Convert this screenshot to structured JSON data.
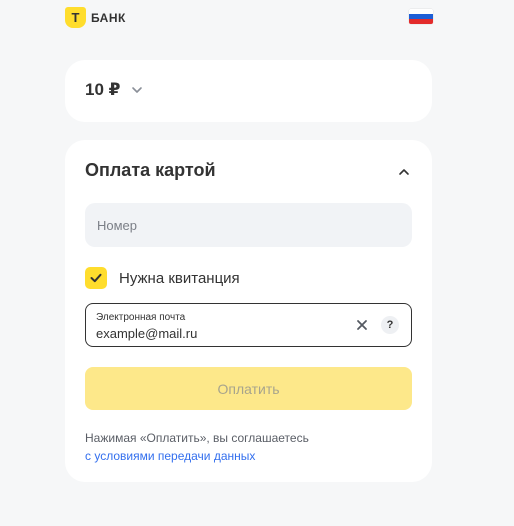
{
  "header": {
    "logo_mark": "Т",
    "logo_text": "БАНК",
    "flag_icon": "russia-flag-icon"
  },
  "amount": {
    "value": "10 ₽",
    "chevron_icon": "chevron-down-icon"
  },
  "payment": {
    "title": "Оплата картой",
    "collapse_icon": "chevron-up-icon",
    "card_number": {
      "placeholder": "Номер",
      "value": ""
    },
    "receipt": {
      "label": "Нужна квитанция",
      "checked": true
    },
    "email": {
      "label": "Электронная почта",
      "value": "example@mail.ru",
      "clear_icon": "close-icon",
      "help_label": "?"
    },
    "pay_button": "Оплатить",
    "terms_text": "Нажимая «Оплатить», вы соглашаетесь",
    "terms_link": "с условиями передачи данных"
  },
  "colors": {
    "background": "#f6f7f8",
    "brand_yellow": "#ffdd2d",
    "pay_button_disabled": "#fde88a",
    "link": "#336fee",
    "text": "#333333"
  }
}
